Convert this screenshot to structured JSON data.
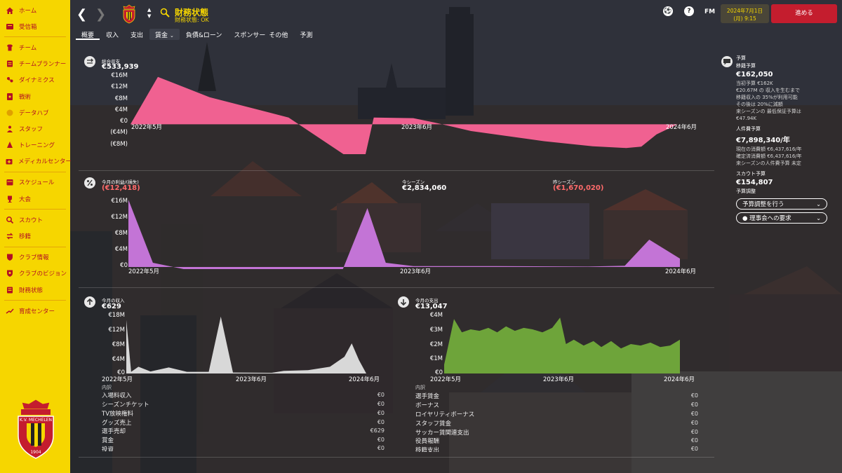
{
  "sidebar": {
    "items": [
      {
        "label": "ホーム",
        "icon": "home-icon"
      },
      {
        "label": "受信箱",
        "icon": "inbox-icon"
      },
      {
        "label": "チーム",
        "icon": "team-icon"
      },
      {
        "label": "チームプランナー",
        "icon": "planner-icon"
      },
      {
        "label": "ダイナミクス",
        "icon": "dynamics-icon"
      },
      {
        "label": "戦術",
        "icon": "tactics-icon"
      },
      {
        "label": "データハブ",
        "icon": "data-hub-icon"
      },
      {
        "label": "スタッフ",
        "icon": "staff-icon"
      },
      {
        "label": "トレーニング",
        "icon": "training-icon"
      },
      {
        "label": "メディカルセンター",
        "icon": "medical-icon"
      },
      {
        "label": "スケジュール",
        "icon": "schedule-icon"
      },
      {
        "label": "大会",
        "icon": "trophy-icon"
      },
      {
        "label": "スカウト",
        "icon": "scout-icon"
      },
      {
        "label": "移籍",
        "icon": "transfer-icon"
      },
      {
        "label": "クラブ情報",
        "icon": "club-info-icon"
      },
      {
        "label": "クラブのビジョン",
        "icon": "vision-icon"
      },
      {
        "label": "財務状態",
        "icon": "finance-icon"
      },
      {
        "label": "育成センター",
        "icon": "development-icon"
      }
    ],
    "crest_text": "K.V. MECHELEN",
    "crest_year": "1904"
  },
  "header": {
    "title": "財務状態",
    "status": "財務状態: OK",
    "fm_logo": "FM",
    "date_line1": "2024年7月1日",
    "date_line2": "(月) 9:15",
    "continue_label": "進める"
  },
  "tabs": [
    {
      "label": "概要",
      "active": true
    },
    {
      "label": "収入",
      "active": false
    },
    {
      "label": "支出",
      "active": false
    },
    {
      "label": "賃金",
      "active": false,
      "dropdown": true
    },
    {
      "label": "負債&ローン",
      "active": false
    },
    {
      "label": "スポンサー",
      "active": false
    },
    {
      "label": "その他",
      "active": false
    },
    {
      "label": "予測",
      "active": false
    }
  ],
  "colors": {
    "sidebar_bg": "#f6d600",
    "sidebar_text": "#b30f24",
    "balance_fill": "#f06191",
    "profit_fill": "#c374d6",
    "income_fill": "#d8d8d8",
    "expense_fill": "#6ea43a",
    "continue_bg": "#c41d2e"
  },
  "balance_panel": {
    "label": "総合収支",
    "value": "€533,939",
    "icon": "balance-icon"
  },
  "profit_panel": {
    "label": "今月の利益/(損失)",
    "value": "(€12,418)",
    "this_season_label": "今シーズン",
    "this_season_value": "€2,834,060",
    "last_season_label": "昨シーズン",
    "last_season_value": "(€1,670,020)",
    "icon": "percent-icon"
  },
  "income_panel": {
    "label": "今月の収入",
    "value": "€629",
    "icon": "arrow-up-icon"
  },
  "expense_panel": {
    "label": "今月の支出",
    "value": "€13,047",
    "icon": "arrow-down-icon"
  },
  "budget": {
    "heading": "予算",
    "transfer_label": "移籍予算",
    "transfer_value": "€162,050",
    "transfer_lines": [
      "当初予算 €162K",
      "€20.67M の 収入を生むまで",
      "移籍収入の 35%が利用可能",
      "その後は 20%に減額",
      "来シーズンの 最低保証予算は",
      "€47.94K"
    ],
    "wage_label": "人件費予算",
    "wage_value": "€7,898,340/年",
    "wage_lines": [
      "現在の消費額 €6,437,616/年",
      "確定済消費額 €6,437,616/年",
      "来シーズンの人件費予算 未定"
    ],
    "scout_label": "スカウト予算",
    "scout_value": "€154,807",
    "adjust_label": "予算調整",
    "adjust_button": "予算調整を行う",
    "request_button": "理事会への要求",
    "icon": "chat-bubble-icon"
  },
  "income_list": {
    "title": "内訳",
    "rows": [
      {
        "label": "入場料収入",
        "value": "€0"
      },
      {
        "label": "シーズンチケット",
        "value": "€0"
      },
      {
        "label": "TV放映権料",
        "value": "€0"
      },
      {
        "label": "グッズ売上",
        "value": "€0"
      },
      {
        "label": "選手売却",
        "value": "€629"
      },
      {
        "label": "賞金",
        "value": "€0"
      },
      {
        "label": "投資",
        "value": "€0"
      }
    ]
  },
  "expense_list": {
    "title": "内訳",
    "rows": [
      {
        "label": "選手賃金",
        "value": "€0"
      },
      {
        "label": "ボーナス",
        "value": "€0"
      },
      {
        "label": "ロイヤリティボーナス",
        "value": "€0"
      },
      {
        "label": "スタッフ賃金",
        "value": "€0"
      },
      {
        "label": "サッカー賃関連支出",
        "value": "€0"
      },
      {
        "label": "役員報酬",
        "value": "€0"
      },
      {
        "label": "移籍支出",
        "value": "€0"
      }
    ]
  },
  "chart_data": [
    {
      "type": "area",
      "ylim": [
        -8,
        16
      ],
      "yticks": [
        "€16M",
        "€12M",
        "€8M",
        "€4M",
        "€0",
        "(€4M)",
        "(€8M)"
      ],
      "xticks": [
        "2022年5月",
        "2023年6月",
        "2024年6月"
      ],
      "series": [
        {
          "points": [
            [
              0,
              0
            ],
            [
              0.09,
              14
            ],
            [
              0.26,
              8
            ],
            [
              0.52,
              2
            ],
            [
              0.72,
              -10
            ],
            [
              0.77,
              -10
            ],
            [
              0.8,
              2
            ],
            [
              0.93,
              1.8
            ],
            [
              1.0,
              0.5
            ],
            [
              1.12,
              -2
            ],
            [
              1.36,
              -5
            ],
            [
              1.52,
              -6.5
            ],
            [
              1.63,
              -7
            ],
            [
              1.68,
              -6.6
            ],
            [
              1.73,
              -3
            ],
            [
              1.8,
              0
            ]
          ]
        }
      ]
    },
    {
      "type": "area",
      "ylim": [
        0,
        16
      ],
      "yticks": [
        "€16M",
        "€12M",
        "€8M",
        "€4M",
        "€0"
      ],
      "xticks": [
        "2022年5月",
        "2023年6月",
        "2024年6月"
      ],
      "series": [
        {
          "points": [
            [
              0,
              16
            ],
            [
              0.08,
              1
            ],
            [
              0.18,
              -0.5
            ],
            [
              0.5,
              -0.5
            ],
            [
              0.7,
              -0.5
            ],
            [
              0.78,
              14
            ],
            [
              0.84,
              1
            ],
            [
              0.93,
              0.2
            ],
            [
              1.2,
              0.2
            ],
            [
              1.5,
              0.1
            ],
            [
              1.62,
              0.3
            ],
            [
              1.7,
              6.5
            ],
            [
              1.8,
              2
            ]
          ]
        }
      ]
    },
    {
      "type": "area",
      "ylim": [
        0,
        18
      ],
      "yticks": [
        "€18M",
        "€12M",
        "€8M",
        "€4M",
        "€0"
      ],
      "xticks": [
        "2022年5月",
        "2023年6月",
        "2024年6月"
      ],
      "series": [
        {
          "points": [
            [
              0,
              16
            ],
            [
              0.04,
              0.5
            ],
            [
              0.1,
              2
            ],
            [
              0.2,
              0.6
            ],
            [
              0.35,
              1.8
            ],
            [
              0.5,
              0.5
            ],
            [
              0.6,
              0.5
            ],
            [
              0.68,
              0.5
            ],
            [
              0.78,
              17
            ],
            [
              0.88,
              0.3
            ],
            [
              1.2,
              0.2
            ],
            [
              1.3,
              0.8
            ],
            [
              1.5,
              1
            ],
            [
              1.68,
              2
            ],
            [
              1.8,
              5
            ],
            [
              1.86,
              9
            ],
            [
              1.92,
              4
            ],
            [
              1.98,
              0
            ]
          ]
        }
      ]
    },
    {
      "type": "area",
      "ylim": [
        0,
        4
      ],
      "yticks": [
        "€4M",
        "€3M",
        "€2M",
        "€1M",
        "€0"
      ],
      "xticks": [
        "2022年5月",
        "2023年6月",
        "2024年6月"
      ],
      "series": [
        {
          "points": [
            [
              0,
              0.6
            ],
            [
              0.1,
              3.7
            ],
            [
              0.18,
              2.8
            ],
            [
              0.27,
              3
            ],
            [
              0.36,
              2.9
            ],
            [
              0.45,
              3.1
            ],
            [
              0.54,
              2.8
            ],
            [
              0.63,
              3.2
            ],
            [
              0.72,
              2.9
            ],
            [
              0.81,
              3.1
            ],
            [
              0.9,
              3
            ],
            [
              1.0,
              2.8
            ],
            [
              1.1,
              3.1
            ],
            [
              1.18,
              3.8
            ],
            [
              1.24,
              2
            ],
            [
              1.32,
              2.3
            ],
            [
              1.42,
              1.9
            ],
            [
              1.52,
              2.2
            ],
            [
              1.6,
              1.8
            ],
            [
              1.7,
              2.2
            ],
            [
              1.8,
              1.7
            ],
            [
              1.9,
              2
            ],
            [
              2.0,
              1.9
            ],
            [
              2.1,
              2.1
            ],
            [
              2.2,
              1.8
            ],
            [
              2.3,
              1.9
            ],
            [
              2.4,
              2.3
            ]
          ]
        }
      ]
    }
  ]
}
